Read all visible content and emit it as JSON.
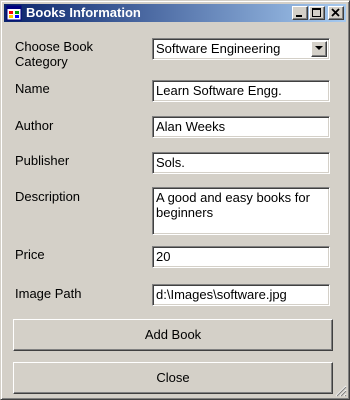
{
  "window": {
    "title": "Books Information",
    "icon": "app-window-icon",
    "controls": {
      "minimize_icon": "minimize-icon",
      "maximize_icon": "maximize-icon",
      "close_icon": "close-icon"
    }
  },
  "form": {
    "category": {
      "label_line1": "Choose Book",
      "label_line2": "Category",
      "value": "Software Engineering"
    },
    "name": {
      "label": "Name",
      "value": "Learn Software Engg."
    },
    "author": {
      "label": "Author",
      "value": "Alan Weeks"
    },
    "publisher": {
      "label": "Publisher",
      "value": "Sols."
    },
    "description": {
      "label": "Description",
      "value": "A good and easy books for beginners"
    },
    "price": {
      "label": "Price",
      "value": "20"
    },
    "image_path": {
      "label": "Image Path",
      "value": "d:\\Images\\software.jpg"
    }
  },
  "buttons": {
    "add_book": "Add Book",
    "close": "Close"
  },
  "colors": {
    "face": "#d4d0c8",
    "title_start": "#0a246a",
    "title_end": "#a6caf0"
  }
}
